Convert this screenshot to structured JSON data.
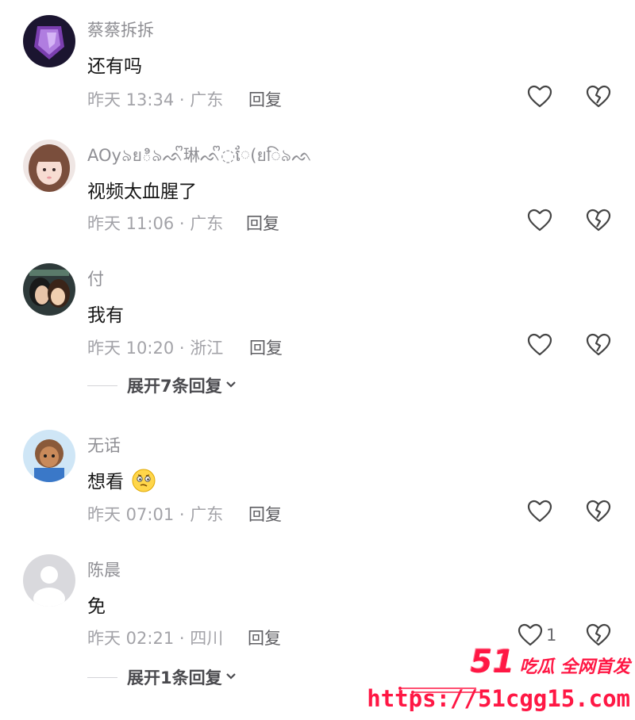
{
  "comments": [
    {
      "username": "蔡蔡拆拆",
      "text": "还有吗",
      "meta": "昨天 13:34 · 广东",
      "reply_label": "回复",
      "like_count": ""
    },
    {
      "username": "AOy৯ยి৯ᨒᩚ琳ᨒᩚ◌ែ(ยि৯ᨒ",
      "text": "视频太血腥了",
      "meta": "昨天 11:06 · 广东",
      "reply_label": "回复",
      "like_count": ""
    },
    {
      "username": "付",
      "text": "我有",
      "meta": "昨天 10:20 · 浙江",
      "reply_label": "回复",
      "like_count": "",
      "expand_label": "展开7条回复"
    },
    {
      "username": "无话",
      "text": "想看",
      "emoji": "🤔",
      "meta": "昨天 07:01 · 广东",
      "reply_label": "回复",
      "like_count": ""
    },
    {
      "username": "陈晨",
      "text": "免",
      "meta": "昨天 02:21 · 四川",
      "reply_label": "回复",
      "like_count": "1",
      "expand_label": "展开1条回复"
    }
  ],
  "icons": {
    "like": "heart-outline-icon",
    "dislike": "broken-heart-icon",
    "expand": "chevron-down-icon"
  },
  "watermark": {
    "number": "51",
    "name": "吃瓜 全网首发",
    "url": "https://51cgg15.com"
  },
  "colors": {
    "username": "#8f8f94",
    "text": "#161616",
    "meta": "#a3a3a8",
    "watermark": "#ff1744"
  }
}
